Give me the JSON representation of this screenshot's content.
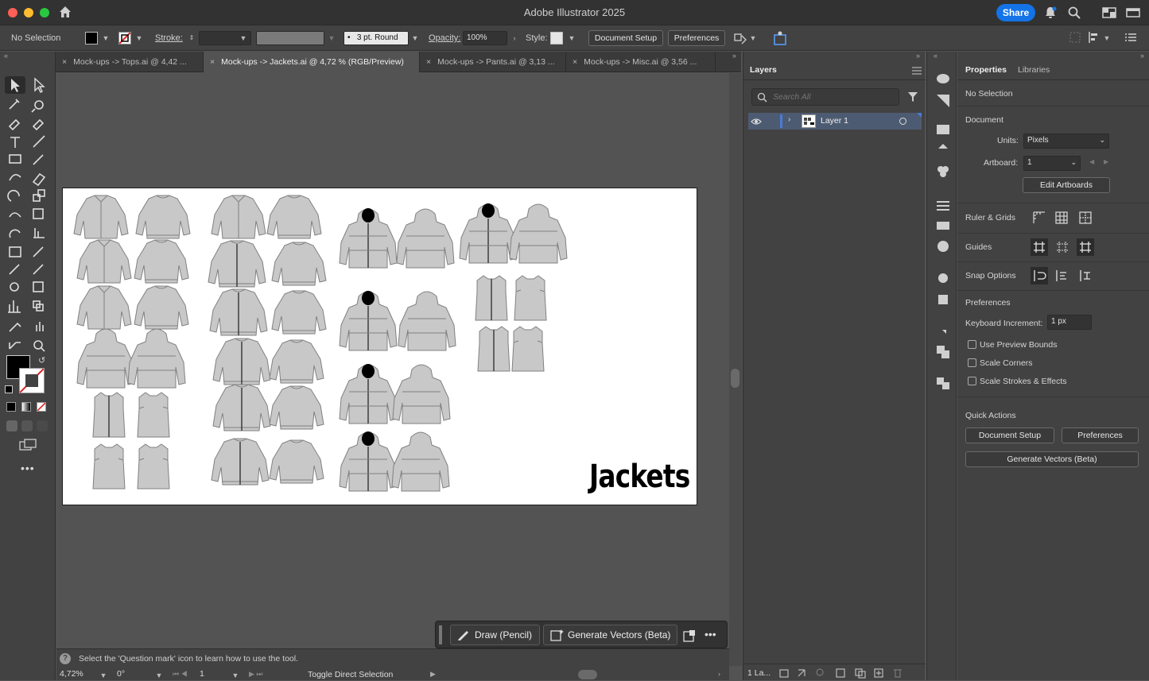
{
  "window": {
    "title": "Adobe Illustrator 2025",
    "share_label": "Share"
  },
  "control_bar": {
    "selection": "No Selection",
    "stroke_label": "Stroke:",
    "brush_value": "3 pt. Round",
    "opacity_label": "Opacity:",
    "opacity_value": "100%",
    "style_label": "Style:",
    "document_setup": "Document Setup",
    "preferences": "Preferences"
  },
  "tabs": [
    {
      "label": "Mock-ups -> Tops.ai @ 4,42 ..."
    },
    {
      "label": "Mock-ups -> Jackets.ai @ 4,72 % (RGB/Preview)"
    },
    {
      "label": "Mock-ups -> Pants.ai @ 3,13 ..."
    },
    {
      "label": "Mock-ups -> Misc.ai @ 3,56 ..."
    }
  ],
  "artboard": {
    "title": "Jackets"
  },
  "float_bar": {
    "draw_label": "Draw (Pencil)",
    "generate_label": "Generate Vectors (Beta)"
  },
  "status": {
    "hint": "Select the 'Question mark' icon to learn how to use the tool.",
    "zoom": "4,72%",
    "rotation": "0°",
    "artboard_num": "1",
    "tool_status": "Toggle Direct Selection"
  },
  "layers_panel": {
    "title": "Layers",
    "search_placeholder": "Search All",
    "layer_name": "Layer 1",
    "footer_count": "1 La..."
  },
  "properties_panel": {
    "tab_properties": "Properties",
    "tab_libraries": "Libraries",
    "selection": "No Selection",
    "document_heading": "Document",
    "units_label": "Units:",
    "units_value": "Pixels",
    "artboard_label": "Artboard:",
    "artboard_value": "1",
    "edit_artboards": "Edit Artboards",
    "ruler_grids": "Ruler & Grids",
    "guides": "Guides",
    "snap_options": "Snap Options",
    "preferences_heading": "Preferences",
    "keyboard_increment_label": "Keyboard Increment:",
    "keyboard_increment_value": "1 px",
    "use_preview_bounds": "Use Preview Bounds",
    "scale_corners": "Scale Corners",
    "scale_strokes": "Scale Strokes & Effects",
    "quick_actions": "Quick Actions",
    "qa_document_setup": "Document Setup",
    "qa_preferences": "Preferences",
    "qa_generate": "Generate Vectors (Beta)"
  },
  "colors": {
    "accent": "#1473e6",
    "layer_color": "#4a7bd3",
    "panel_bg": "#424242",
    "canvas_bg": "#535353"
  }
}
